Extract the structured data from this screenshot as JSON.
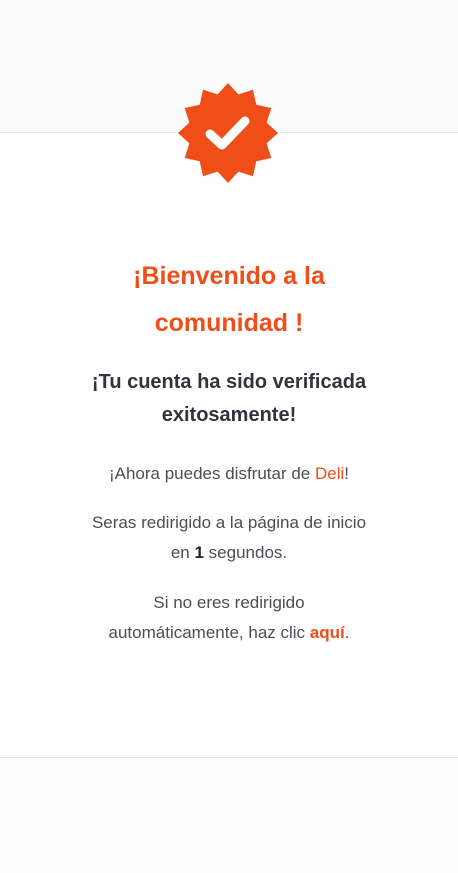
{
  "colors": {
    "accent": "#f04e18",
    "text_dark": "#33333f",
    "text_body": "#4d4d55"
  },
  "badge": {
    "icon": "verified-check-icon"
  },
  "title": {
    "line1": "¡Bienvenido a la",
    "line2": "comunidad !"
  },
  "subtitle": {
    "line1": "¡Tu cuenta ha sido verificada",
    "line2": "exitosamente!"
  },
  "enjoy": {
    "prefix": "¡Ahora puedes disfrutar de ",
    "brand": "Deli",
    "suffix": "!"
  },
  "redirect": {
    "line1": "Seras redirigido a la página de inicio",
    "prefix": "en ",
    "seconds": "1",
    "suffix": " segundos."
  },
  "manual": {
    "line1": "Si no eres redirigido",
    "prefix": "automáticamente, haz clic ",
    "link_label": "aquí",
    "suffix": "."
  }
}
